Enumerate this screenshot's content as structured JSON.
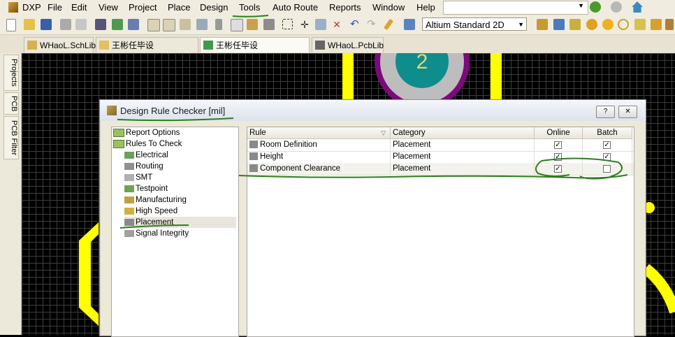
{
  "menu": {
    "dxp": "DXP",
    "items": [
      "File",
      "Edit",
      "View",
      "Project",
      "Place",
      "Design",
      "Tools",
      "Auto Route",
      "Reports",
      "Window",
      "Help"
    ]
  },
  "toolbar": {
    "view_mode": "Altium Standard 2D"
  },
  "tabs": [
    {
      "label": "WHaoL.SchLib"
    },
    {
      "label": "王彬任毕设PCB.SchDoc"
    },
    {
      "label": "王彬任毕设PCB.PcbDoc *"
    },
    {
      "label": "WHaoL.PcbLib"
    }
  ],
  "side_panels": [
    "Projects",
    "PCB",
    "PCB Filter"
  ],
  "canvas": {
    "pad_number": "2"
  },
  "dialog": {
    "title": "Design Rule Checker [mil]",
    "help_label": "?",
    "close_label": "✕",
    "tree": [
      {
        "label": "Report Options"
      },
      {
        "label": "Rules To Check"
      },
      {
        "label": "Electrical"
      },
      {
        "label": "Routing"
      },
      {
        "label": "SMT"
      },
      {
        "label": "Testpoint"
      },
      {
        "label": "Manufacturing"
      },
      {
        "label": "High Speed"
      },
      {
        "label": "Placement"
      },
      {
        "label": "Signal Integrity"
      }
    ],
    "columns": {
      "rule": "Rule",
      "category": "Category",
      "online": "Online",
      "batch": "Batch"
    },
    "rows": [
      {
        "rule": "Room Definition",
        "category": "Placement",
        "online": true,
        "batch": true
      },
      {
        "rule": "Height",
        "category": "Placement",
        "online": true,
        "batch": true
      },
      {
        "rule": "Component Clearance",
        "category": "Placement",
        "online": true,
        "batch": false
      }
    ]
  },
  "colors": {
    "annotation": "#2e7d1f",
    "trace": "#ffff00",
    "pad_ring": "#7b0a7b",
    "pad_center": "#0f8c8c"
  }
}
